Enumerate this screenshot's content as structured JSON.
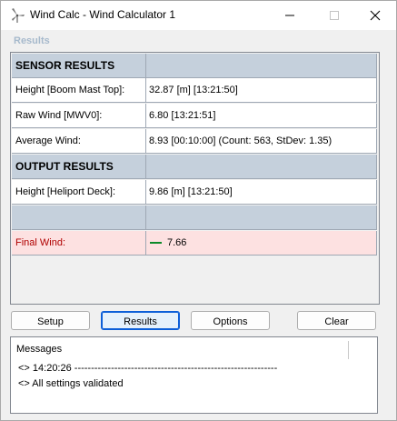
{
  "window": {
    "title": "Wind Calc - Wind Calculator 1"
  },
  "results_group": {
    "label": "Results"
  },
  "grid": {
    "rows": [
      {
        "kind": "header",
        "label": "SENSOR RESULTS",
        "value": ""
      },
      {
        "kind": "data",
        "label": "Height [Boom Mast Top]:",
        "value": "32.87 [m] [13:21:50]"
      },
      {
        "kind": "data",
        "label": "Raw Wind [MWV0]:",
        "value": "6.80 [13:21:51]"
      },
      {
        "kind": "data",
        "label": "Average Wind:",
        "value": "8.93 [00:10:00]  (Count: 563, StDev: 1.35)"
      },
      {
        "kind": "header",
        "label": "OUTPUT RESULTS",
        "value": ""
      },
      {
        "kind": "data",
        "label": "Height [Heliport Deck]:",
        "value": "9.86 [m] [13:21:50]"
      },
      {
        "kind": "header",
        "label": "",
        "value": ""
      },
      {
        "kind": "final",
        "label": "Final Wind:",
        "value": "7.66",
        "indicator_color": "#0d8a2a"
      }
    ]
  },
  "buttons": {
    "setup": "Setup",
    "results": "Results",
    "options": "Options",
    "clear": "Clear"
  },
  "messages": {
    "title": "Messages",
    "lines": [
      "<> 14:20:26 -------------------------------------------------------------",
      "<> All settings validated"
    ]
  },
  "colors": {
    "header_bg": "#c5d0dc",
    "final_bg": "#fde1e1",
    "active_button_border": "#0c5fd8"
  }
}
